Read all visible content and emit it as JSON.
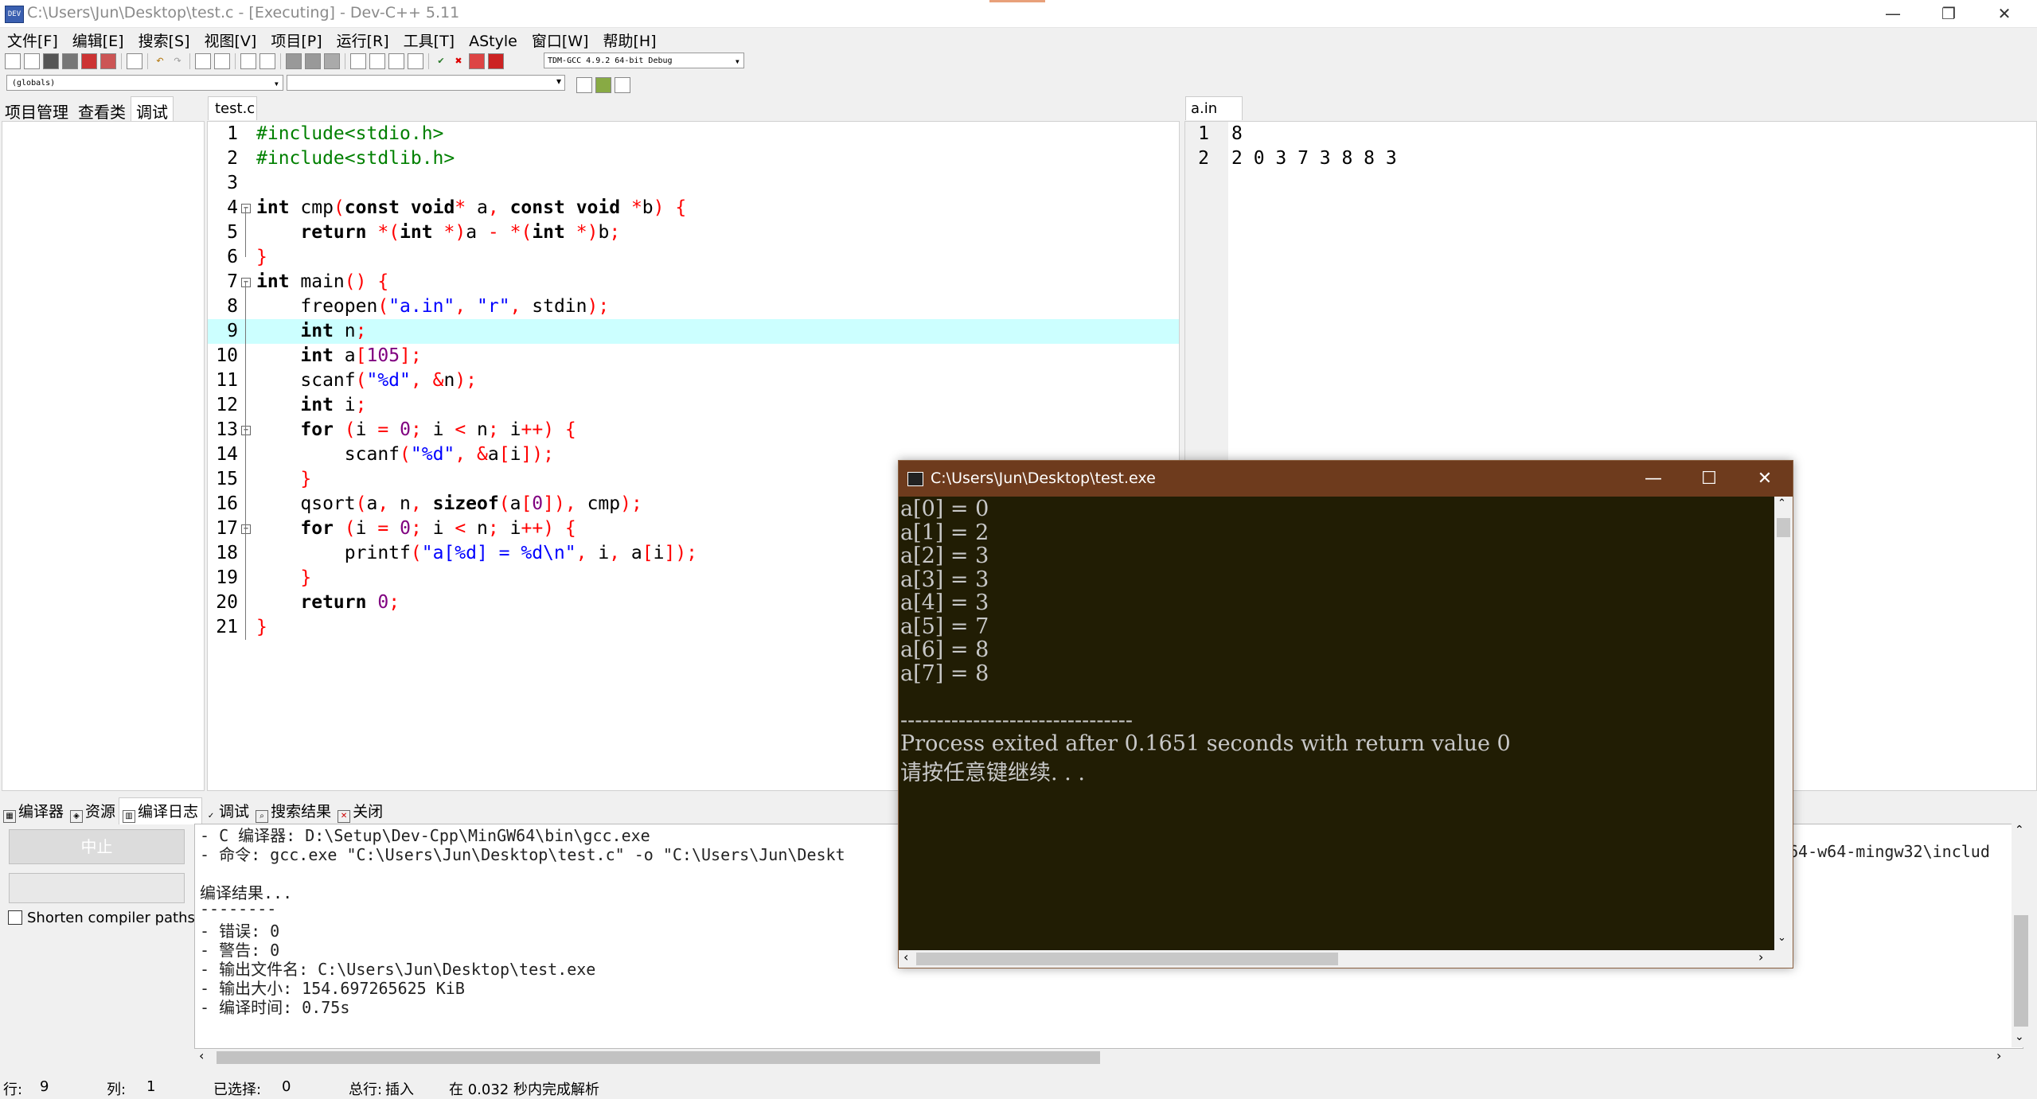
{
  "window": {
    "title": "C:\\Users\\Jun\\Desktop\\test.c - [Executing] - Dev-C++ 5.11",
    "icon_text": "DEV",
    "minimize": "—",
    "restore": "❐",
    "close": "✕"
  },
  "menu": [
    "文件[F]",
    "编辑[E]",
    "搜索[S]",
    "视图[V]",
    "项目[P]",
    "运行[R]",
    "工具[T]",
    "AStyle",
    "窗口[W]",
    "帮助[H]"
  ],
  "toolbar": {
    "compiler": "TDM-GCC 4.9.2 64-bit Debug",
    "scope": "(globals)"
  },
  "left_tabs": [
    "项目管理",
    "查看类",
    "调试"
  ],
  "editor": {
    "tab": "test.c",
    "current_line": 9,
    "lines": [
      {
        "n": "1",
        "t": "#include<stdio.h>"
      },
      {
        "n": "2",
        "t": "#include<stdlib.h>"
      },
      {
        "n": "3",
        "t": ""
      },
      {
        "n": "4",
        "t": "int cmp(const void* a, const void *b) {"
      },
      {
        "n": "5",
        "t": "    return *(int *)a - *(int *)b;"
      },
      {
        "n": "6",
        "t": "}"
      },
      {
        "n": "7",
        "t": "int main() {"
      },
      {
        "n": "8",
        "t": "    freopen(\"a.in\", \"r\", stdin);"
      },
      {
        "n": "9",
        "t": "    int n;"
      },
      {
        "n": "10",
        "t": "    int a[105];"
      },
      {
        "n": "11",
        "t": "    scanf(\"%d\", &n);"
      },
      {
        "n": "12",
        "t": "    int i;"
      },
      {
        "n": "13",
        "t": "    for (i = 0; i < n; i++) {"
      },
      {
        "n": "14",
        "t": "        scanf(\"%d\", &a[i]);"
      },
      {
        "n": "15",
        "t": "    }"
      },
      {
        "n": "16",
        "t": "    qsort(a, n, sizeof(a[0]), cmp);"
      },
      {
        "n": "17",
        "t": "    for (i = 0; i < n; i++) {"
      },
      {
        "n": "18",
        "t": "        printf(\"a[%d] = %d\\n\", i, a[i]);"
      },
      {
        "n": "19",
        "t": "    }"
      },
      {
        "n": "20",
        "t": "    return 0;"
      },
      {
        "n": "21",
        "t": "}"
      }
    ]
  },
  "ain": {
    "tab": "a.in",
    "lines": [
      {
        "n": "1",
        "t": "8"
      },
      {
        "n": "2",
        "t": "2 0 3 7 3 8 8 3"
      }
    ]
  },
  "bottom_tabs": [
    "编译器",
    "资源",
    "编译日志",
    "调试",
    "搜索结果",
    "关闭"
  ],
  "compile": {
    "stop_label": "中止",
    "shorten_label": "Shorten compiler paths",
    "log": [
      "- C 编译器: D:\\Setup\\Dev-Cpp\\MinGW64\\bin\\gcc.exe",
      "- 命令: gcc.exe \"C:\\Users\\Jun\\Desktop\\test.c\" -o \"C:\\Users\\Jun\\Deskt",
      "",
      "编译结果...",
      "--------",
      "- 错误: 0",
      "- 警告: 0",
      "- 输出文件名: C:\\Users\\Jun\\Desktop\\test.exe",
      "- 输出大小: 154.697265625 KiB",
      "- 编译时间: 0.75s"
    ],
    "log_right_fragment": "64-w64-mingw32\\includ"
  },
  "status": {
    "row_label": "行:",
    "row_value": "9",
    "col_label": "列:",
    "col_value": "1",
    "sel_label": "已选择:",
    "sel_value": "0",
    "total_label": "总行:",
    "insert_label": "插入",
    "parse_msg": "在 0.032 秒内完成解析"
  },
  "console": {
    "title": "C:\\Users\\Jun\\Desktop\\test.exe",
    "minimize": "—",
    "maximize": "☐",
    "close": "✕",
    "lines": [
      "a[0] = 0",
      "a[1] = 2",
      "a[2] = 3",
      "a[3] = 3",
      "a[4] = 3",
      "a[5] = 7",
      "a[6] = 8",
      "a[7] = 8",
      "",
      "--------------------------------",
      "Process exited after 0.1651 seconds with return value 0",
      "请按任意键继续. . ."
    ]
  },
  "colors": {
    "current_line": "#ccffff",
    "console_bg": "#211d04",
    "console_title": "#6e3b1d"
  }
}
